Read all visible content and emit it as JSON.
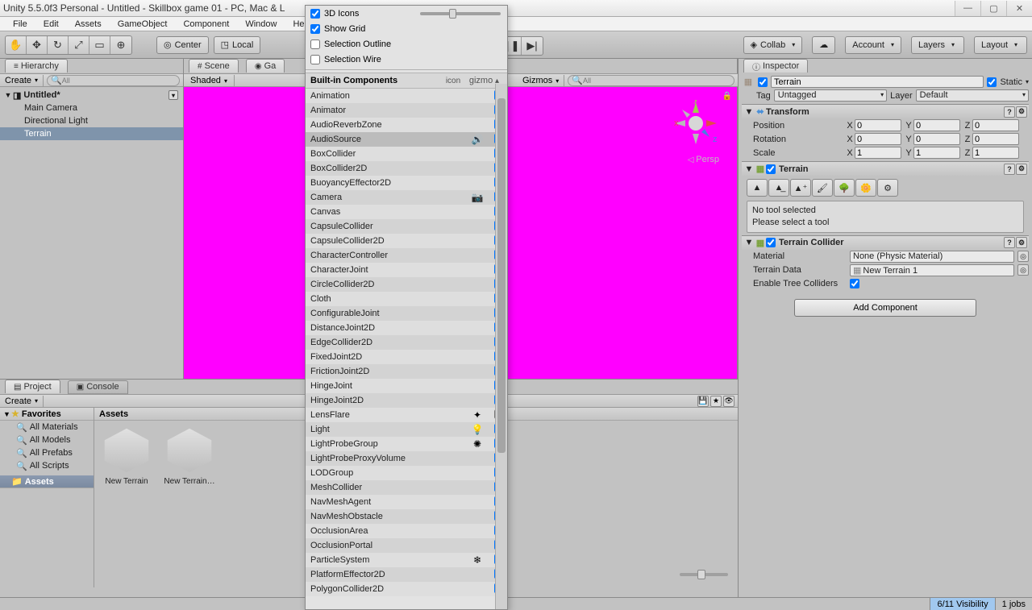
{
  "window": {
    "title": "Unity 5.5.0f3 Personal - Untitled - Skillbox game 01 - PC, Mac & L"
  },
  "menu": {
    "items": [
      "File",
      "Edit",
      "Assets",
      "GameObject",
      "Component",
      "Window",
      "Help"
    ]
  },
  "toolbar": {
    "center_btn": "Center",
    "local_btn": "Local",
    "collab": "Collab",
    "account": "Account",
    "layers": "Layers",
    "layout": "Layout"
  },
  "hierarchy": {
    "tab": "Hierarchy",
    "create": "Create",
    "search_placeholder": "All",
    "scene_name": "Untitled*",
    "items": [
      "Main Camera",
      "Directional Light",
      "Terrain"
    ],
    "selected_index": 2
  },
  "scene_panel": {
    "tab_scene": "Scene",
    "tab_game": "Ga",
    "shaded": "Shaded",
    "gizmos_label": "Gizmos",
    "search_placeholder": "All",
    "persp": "Persp"
  },
  "gizmos_dropdown": {
    "opt_3d_icons": "3D Icons",
    "opt_show_grid": "Show Grid",
    "opt_sel_outline": "Selection Outline",
    "opt_sel_wire": "Selection Wire",
    "section_header": "Built-in Components",
    "col_icon": "icon",
    "col_gizmo": "gizmo",
    "rows": [
      {
        "name": "Animation",
        "icon": "",
        "checked": true
      },
      {
        "name": "Animator",
        "icon": "",
        "checked": true
      },
      {
        "name": "AudioReverbZone",
        "icon": "",
        "checked": true
      },
      {
        "name": "AudioSource",
        "icon": "🔊",
        "checked": true,
        "sel": true
      },
      {
        "name": "BoxCollider",
        "icon": "",
        "checked": true
      },
      {
        "name": "BoxCollider2D",
        "icon": "",
        "checked": true
      },
      {
        "name": "BuoyancyEffector2D",
        "icon": "",
        "checked": true
      },
      {
        "name": "Camera",
        "icon": "📷",
        "checked": true
      },
      {
        "name": "Canvas",
        "icon": "",
        "checked": true
      },
      {
        "name": "CapsuleCollider",
        "icon": "",
        "checked": true
      },
      {
        "name": "CapsuleCollider2D",
        "icon": "",
        "checked": true
      },
      {
        "name": "CharacterController",
        "icon": "",
        "checked": true
      },
      {
        "name": "CharacterJoint",
        "icon": "",
        "checked": true
      },
      {
        "name": "CircleCollider2D",
        "icon": "",
        "checked": true
      },
      {
        "name": "Cloth",
        "icon": "",
        "checked": true
      },
      {
        "name": "ConfigurableJoint",
        "icon": "",
        "checked": true
      },
      {
        "name": "DistanceJoint2D",
        "icon": "",
        "checked": true
      },
      {
        "name": "EdgeCollider2D",
        "icon": "",
        "checked": true
      },
      {
        "name": "FixedJoint2D",
        "icon": "",
        "checked": true
      },
      {
        "name": "FrictionJoint2D",
        "icon": "",
        "checked": true
      },
      {
        "name": "HingeJoint",
        "icon": "",
        "checked": true
      },
      {
        "name": "HingeJoint2D",
        "icon": "",
        "checked": true
      },
      {
        "name": "LensFlare",
        "icon": "✦",
        "checked": false
      },
      {
        "name": "Light",
        "icon": "💡",
        "checked": true
      },
      {
        "name": "LightProbeGroup",
        "icon": "✺",
        "checked": true
      },
      {
        "name": "LightProbeProxyVolume",
        "icon": "",
        "checked": true
      },
      {
        "name": "LODGroup",
        "icon": "",
        "checked": true
      },
      {
        "name": "MeshCollider",
        "icon": "",
        "checked": true
      },
      {
        "name": "NavMeshAgent",
        "icon": "",
        "checked": true
      },
      {
        "name": "NavMeshObstacle",
        "icon": "",
        "checked": true
      },
      {
        "name": "OcclusionArea",
        "icon": "",
        "checked": true
      },
      {
        "name": "OcclusionPortal",
        "icon": "",
        "checked": true
      },
      {
        "name": "ParticleSystem",
        "icon": "❄",
        "checked": true
      },
      {
        "name": "PlatformEffector2D",
        "icon": "",
        "checked": true
      },
      {
        "name": "PolygonCollider2D",
        "icon": "",
        "checked": true
      }
    ]
  },
  "inspector": {
    "tab": "Inspector",
    "static": "Static",
    "name": "Terrain",
    "tag_label": "Tag",
    "tag_value": "Untagged",
    "layer_label": "Layer",
    "layer_value": "Default",
    "transform": {
      "title": "Transform",
      "pos_label": "Position",
      "px": "0",
      "py": "0",
      "pz": "0",
      "rot_label": "Rotation",
      "rx": "0",
      "ry": "0",
      "rz": "0",
      "scl_label": "Scale",
      "sx": "1",
      "sy": "1",
      "sz": "1"
    },
    "terrain": {
      "title": "Terrain",
      "notool1": "No tool selected",
      "notool2": "Please select a tool"
    },
    "terrain_collider": {
      "title": "Terrain Collider",
      "material_label": "Material",
      "material_value": "None (Physic Material)",
      "data_label": "Terrain Data",
      "data_value": "New Terrain 1",
      "tree_label": "Enable Tree Colliders"
    },
    "add_component": "Add Component"
  },
  "project": {
    "tab_project": "Project",
    "tab_console": "Console",
    "create": "Create",
    "favorites": "Favorites",
    "fav_items": [
      "All Materials",
      "All Models",
      "All Prefabs",
      "All Scripts"
    ],
    "assets": "Assets",
    "assets_header": "Assets",
    "items": [
      "New Terrain",
      "New Terrain…"
    ]
  },
  "status": {
    "visibility": "6/11 Visibility",
    "jobs": "1 jobs"
  }
}
